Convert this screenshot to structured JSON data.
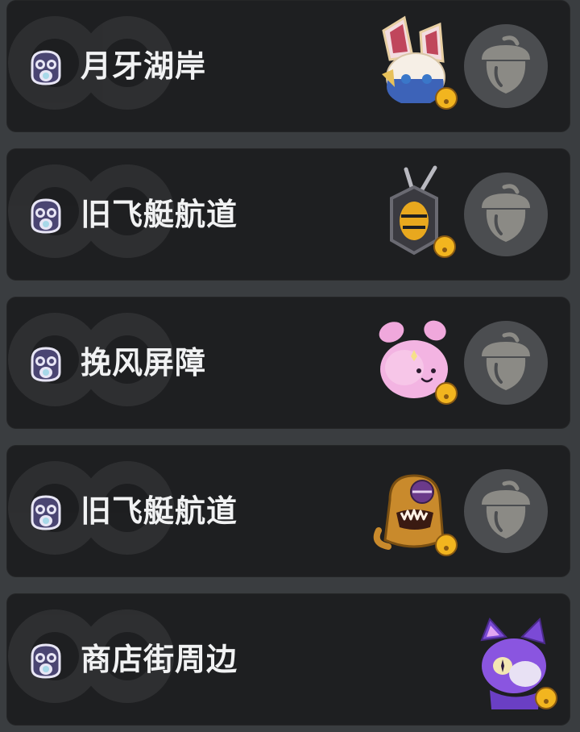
{
  "locations": [
    {
      "title": "月牙湖岸",
      "pet": "rabbit-knight-pet-icon",
      "has_acorn_button": true
    },
    {
      "title": "旧飞艇航道",
      "pet": "wasp-shield-pet-icon",
      "has_acorn_button": true
    },
    {
      "title": "挽风屏障",
      "pet": "pink-bunny-pet-icon",
      "has_acorn_button": true
    },
    {
      "title": "旧飞艇航道",
      "pet": "orange-cyclops-pet-icon",
      "has_acorn_button": true
    },
    {
      "title": "商店街周边",
      "pet": "purple-cat-pet-icon",
      "has_acorn_button": false
    }
  ],
  "colors": {
    "row_background": "#1e1f21",
    "page_background": "#3a3d40",
    "title_text": "#f1f2f3",
    "acorn_button": "#4b4d50",
    "acorn_glyph": "#8b8a85",
    "bell": "#f2b51f",
    "pin_icon": "#4a4572"
  }
}
